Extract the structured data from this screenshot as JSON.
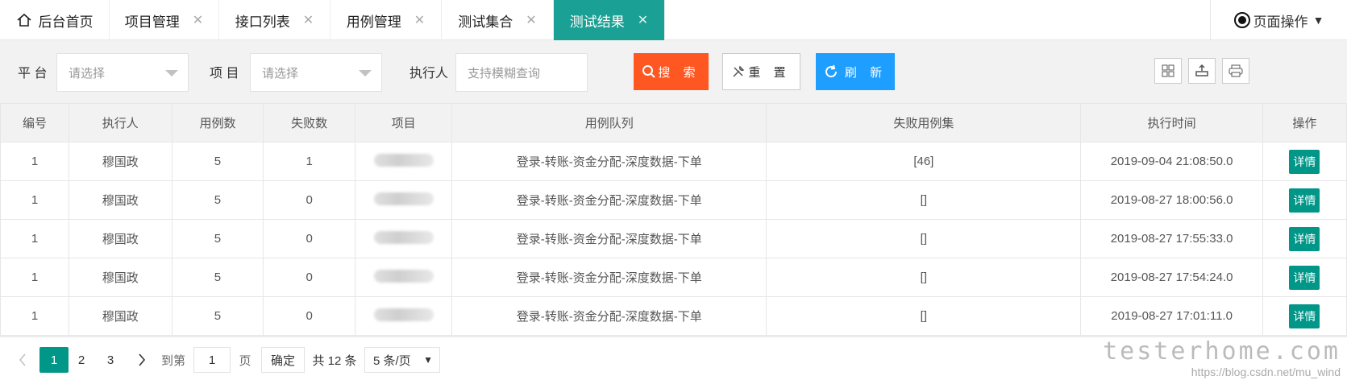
{
  "tabs": [
    {
      "label": "后台首页",
      "closable": false
    },
    {
      "label": "项目管理",
      "closable": true
    },
    {
      "label": "接口列表",
      "closable": true
    },
    {
      "label": "用例管理",
      "closable": true
    },
    {
      "label": "测试集合",
      "closable": true
    },
    {
      "label": "测试结果",
      "closable": true,
      "active": true
    }
  ],
  "close_glyph": "✕",
  "page_ops": {
    "label": "页面操作"
  },
  "filters": {
    "platform_label": "平 台",
    "platform_placeholder": "请选择",
    "project_label": "项 目",
    "project_placeholder": "请选择",
    "executor_label": "执行人",
    "executor_placeholder": "支持模糊查询",
    "search_label": "搜 索",
    "reset_label": "重 置",
    "refresh_label": "刷 新"
  },
  "table": {
    "headers": [
      "编号",
      "执行人",
      "用例数",
      "失败数",
      "项目",
      "用例队列",
      "失败用例集",
      "执行时间",
      "操作"
    ],
    "rows": [
      {
        "id": "1",
        "executor": "穆国政",
        "cases": "5",
        "failed": "1",
        "project": "",
        "queue": "登录-转账-资金分配-深度数据-下单",
        "failed_set": "[46]",
        "time": "2019-09-04 21:08:50.0",
        "action": "详情"
      },
      {
        "id": "1",
        "executor": "穆国政",
        "cases": "5",
        "failed": "0",
        "project": "",
        "queue": "登录-转账-资金分配-深度数据-下单",
        "failed_set": "[]",
        "time": "2019-08-27 18:00:56.0",
        "action": "详情"
      },
      {
        "id": "1",
        "executor": "穆国政",
        "cases": "5",
        "failed": "0",
        "project": "",
        "queue": "登录-转账-资金分配-深度数据-下单",
        "failed_set": "[]",
        "time": "2019-08-27 17:55:33.0",
        "action": "详情"
      },
      {
        "id": "1",
        "executor": "穆国政",
        "cases": "5",
        "failed": "0",
        "project": "",
        "queue": "登录-转账-资金分配-深度数据-下单",
        "failed_set": "[]",
        "time": "2019-08-27 17:54:24.0",
        "action": "详情"
      },
      {
        "id": "1",
        "executor": "穆国政",
        "cases": "5",
        "failed": "0",
        "project": "",
        "queue": "登录-转账-资金分配-深度数据-下单",
        "failed_set": "[]",
        "time": "2019-08-27 17:01:11.0",
        "action": "详情"
      }
    ]
  },
  "pagination": {
    "pages": [
      "1",
      "2",
      "3"
    ],
    "current": "1",
    "goto_label": "到第",
    "goto_value": "1",
    "page_unit": "页",
    "confirm_label": "确定",
    "total_label": "共 12 条",
    "page_size_label": "5 条/页"
  },
  "watermark": {
    "brand": "testerhome.com",
    "url": "https://blog.csdn.net/mu_wind"
  },
  "colors": {
    "active_tab": "#1aa094",
    "search": "#ff5722",
    "refresh": "#1e9fff",
    "detail": "#009688"
  }
}
